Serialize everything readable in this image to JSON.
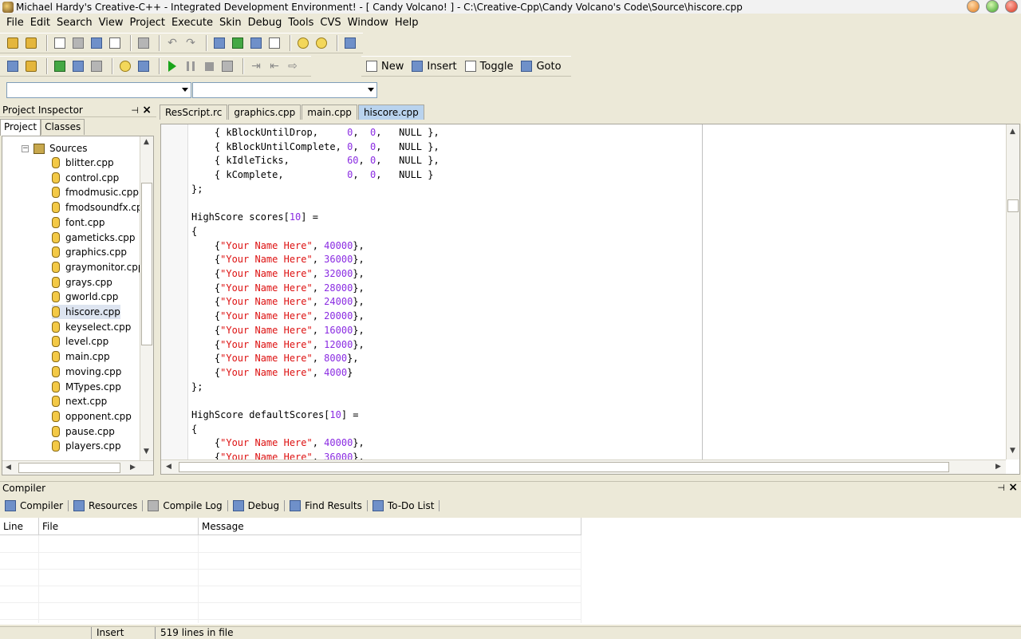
{
  "window": {
    "title": "Michael Hardy's Creative-C++ - Integrated Development Environment!  - [ Candy Volcano! ] - C:\\Creative-Cpp\\Candy Volcano's Code\\Source\\hiscore.cpp"
  },
  "menu": [
    "File",
    "Edit",
    "Search",
    "View",
    "Project",
    "Execute",
    "Skin",
    "Debug",
    "Tools",
    "CVS",
    "Window",
    "Help"
  ],
  "toolbar_labeled": [
    {
      "label": "New",
      "icon": "new-doc-icon"
    },
    {
      "label": "Insert",
      "icon": "insert-icon"
    },
    {
      "label": "Toggle",
      "icon": "toggle-bookmark-icon"
    },
    {
      "label": "Goto",
      "icon": "goto-icon"
    }
  ],
  "inspector": {
    "title": "Project Inspector",
    "tabs": [
      "Project",
      "Classes"
    ],
    "root": "Sources",
    "files": [
      "blitter.cpp",
      "control.cpp",
      "fmodmusic.cpp",
      "fmodsoundfx.cpp",
      "font.cpp",
      "gameticks.cpp",
      "graphics.cpp",
      "graymonitor.cpp",
      "grays.cpp",
      "gworld.cpp",
      "hiscore.cpp",
      "keyselect.cpp",
      "level.cpp",
      "main.cpp",
      "moving.cpp",
      "MTypes.cpp",
      "next.cpp",
      "opponent.cpp",
      "pause.cpp",
      "players.cpp"
    ],
    "selected": "hiscore.cpp"
  },
  "editor": {
    "tabs": [
      "ResScript.rc",
      "graphics.cpp",
      "main.cpp",
      "hiscore.cpp"
    ],
    "active_tab": "hiscore.cpp"
  },
  "compiler": {
    "title": "Compiler",
    "tabs": [
      "Compiler",
      "Resources",
      "Compile Log",
      "Debug",
      "Find Results",
      "To-Do List"
    ],
    "columns": [
      "Line",
      "File",
      "Message"
    ]
  },
  "status": {
    "mode": "Insert",
    "lines": "519 lines in file"
  }
}
